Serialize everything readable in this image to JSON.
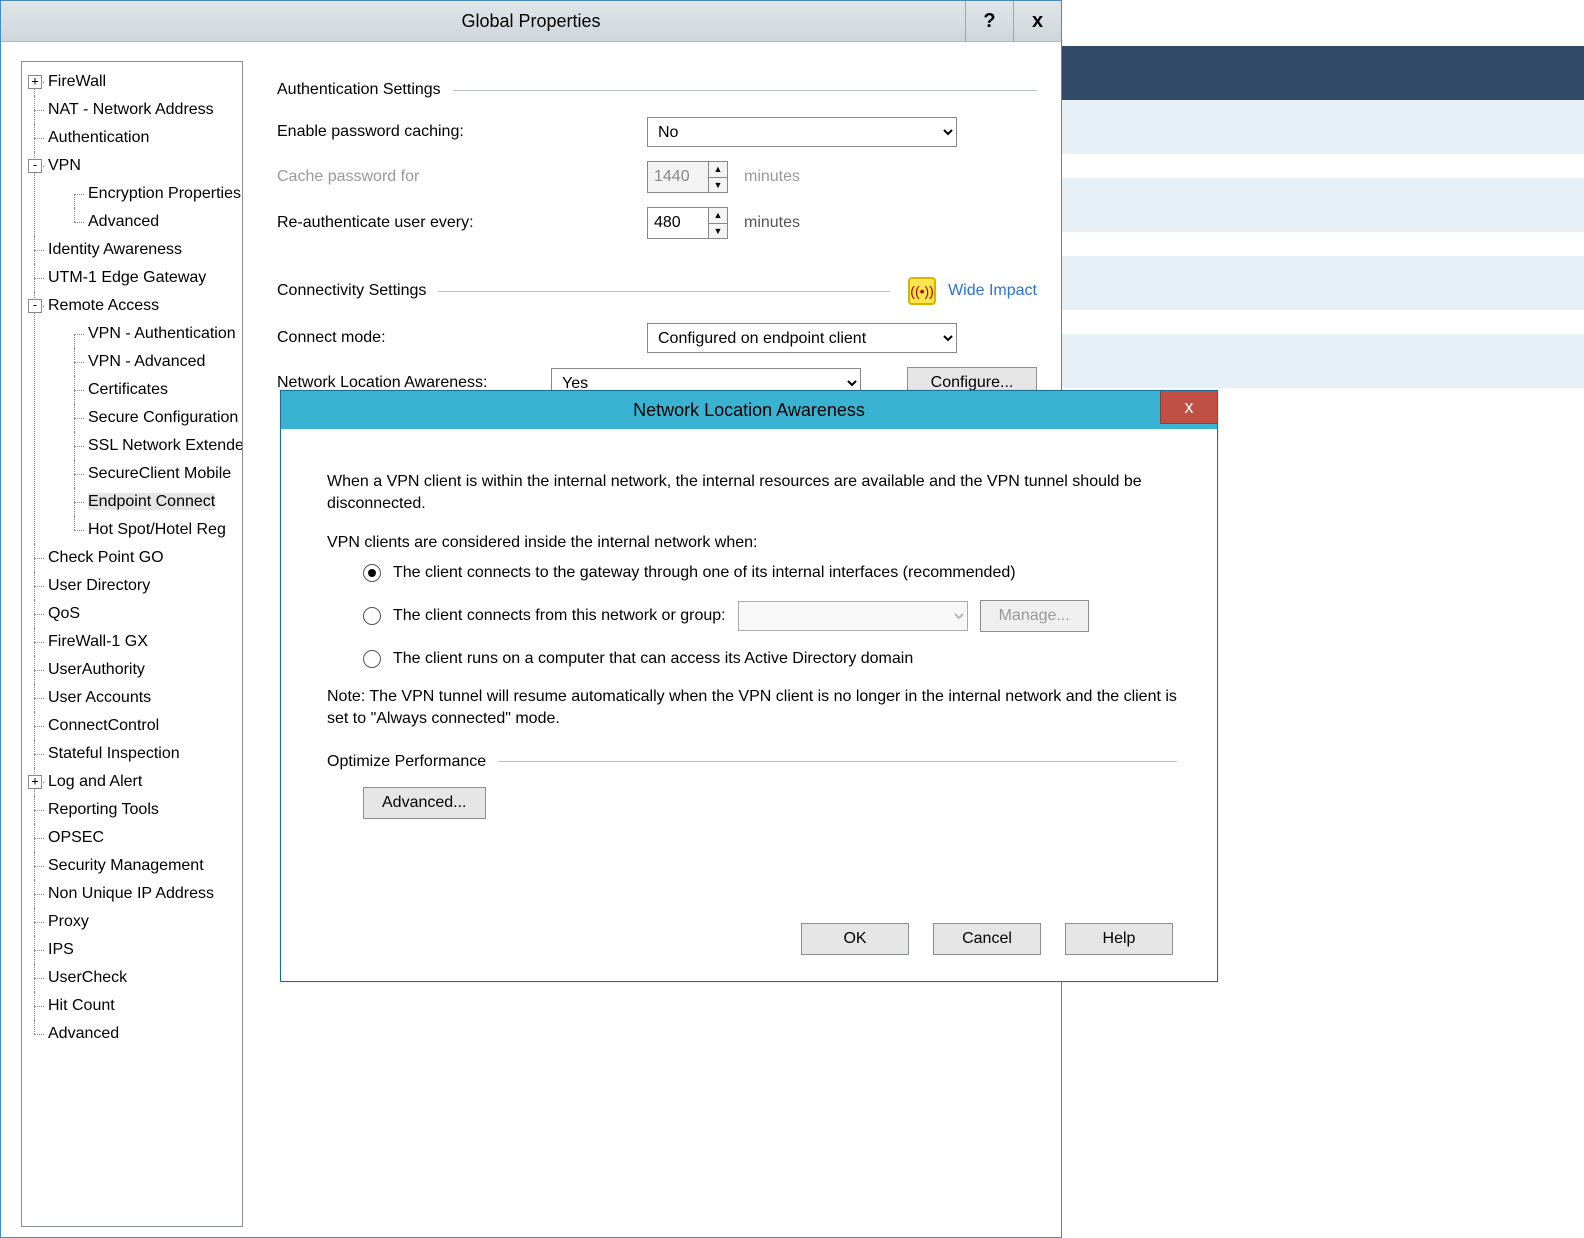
{
  "parent": {
    "title": "Global Properties",
    "help_glyph": "?",
    "close_glyph": "x"
  },
  "tree": {
    "firewall": "FireWall",
    "nat": "NAT - Network Address",
    "authentication": "Authentication",
    "vpn": "VPN",
    "vpn_encryption": "Encryption Properties",
    "vpn_advanced": "Advanced",
    "identity": "Identity Awareness",
    "utm": "UTM-1 Edge Gateway",
    "remote_access": "Remote Access",
    "ra_auth": "VPN - Authentication",
    "ra_adv": "VPN - Advanced",
    "ra_cert": "Certificates",
    "ra_secure_conf": "Secure Configuration",
    "ra_ssl": "SSL Network Extender",
    "ra_sc_mobile": "SecureClient Mobile",
    "ra_endpoint": "Endpoint Connect",
    "ra_hotspot": "Hot Spot/Hotel Reg",
    "cp_go": "Check Point GO",
    "user_dir": "User Directory",
    "qos": "QoS",
    "fw1gx": "FireWall-1 GX",
    "user_authority": "UserAuthority",
    "user_accounts": "User Accounts",
    "connectcontrol": "ConnectControl",
    "stateful": "Stateful Inspection",
    "log_alert": "Log and Alert",
    "reporting": "Reporting Tools",
    "opsec": "OPSEC",
    "sec_mgmt": "Security Management ",
    "non_unique": "Non Unique IP Address",
    "proxy": "Proxy",
    "ips": "IPS",
    "usercheck": "UserCheck",
    "hitcount": "Hit Count",
    "advanced": "Advanced"
  },
  "auth_section": {
    "title": "Authentication Settings",
    "enable_caching_label": "Enable password caching:",
    "enable_caching_value": "No",
    "cache_for_label": "Cache password for",
    "cache_for_value": "1440",
    "cache_for_unit": "minutes",
    "reauth_label": "Re-authenticate user every:",
    "reauth_value": "480",
    "reauth_unit": "minutes"
  },
  "conn_section": {
    "title": "Connectivity Settings",
    "wide_impact_label": "Wide Impact",
    "connect_mode_label": "Connect mode:",
    "connect_mode_value": "Configured on endpoint client",
    "nla_label": "Network Location Awareness:",
    "nla_value": "Yes",
    "configure_btn": "Configure..."
  },
  "modal": {
    "title": "Network Location Awareness",
    "close_glyph": "x",
    "intro": "When a VPN client is within the internal network, the internal resources are available and the VPN tunnel should be disconnected.",
    "consider_inside": "VPN clients are considered inside the internal network when:",
    "opt1": "The client connects to the gateway through one of its internal interfaces (recommended)",
    "opt2": "The client connects from this network or group:",
    "opt3": "The client runs on a computer that can access its Active Directory domain",
    "manage_btn": "Manage...",
    "note": "Note: The VPN tunnel will resume automatically when the VPN client is no longer in the internal network and the client is set to \"Always connected\" mode.",
    "optimize_title": "Optimize Performance",
    "advanced_btn": "Advanced...",
    "ok": "OK",
    "cancel": "Cancel",
    "help": "Help"
  }
}
